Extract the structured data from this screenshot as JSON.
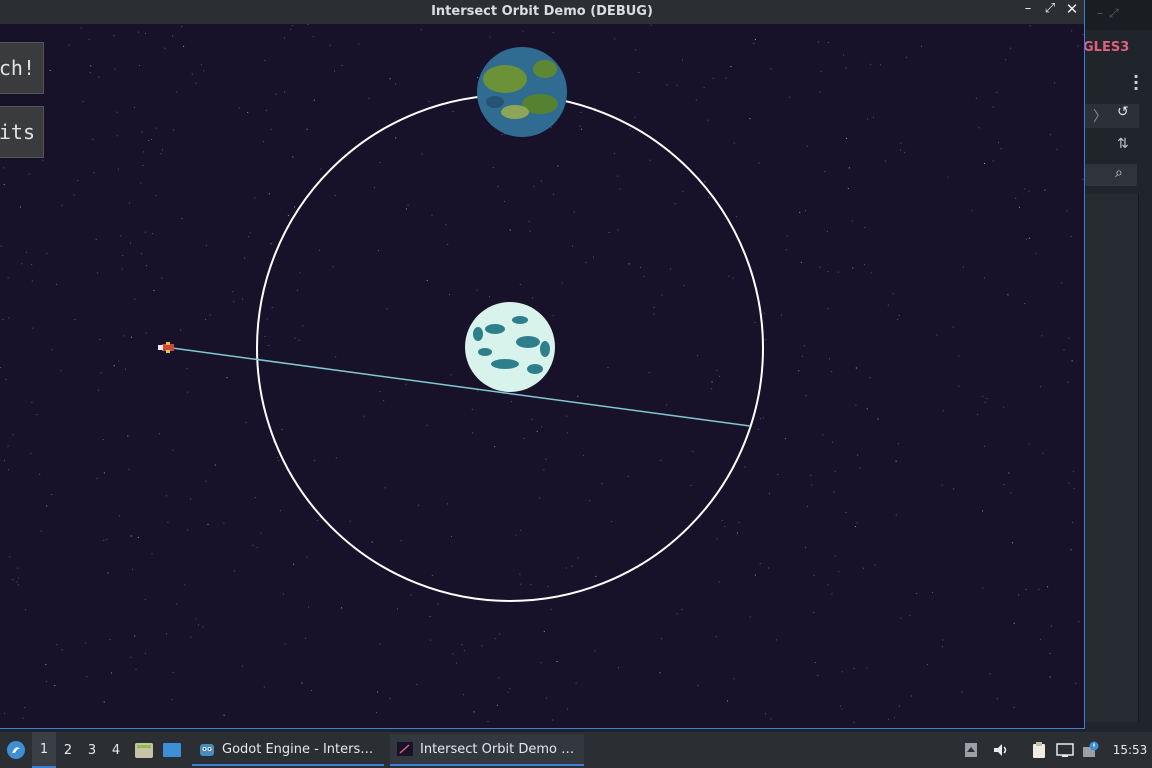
{
  "window": {
    "title": "Intersect Orbit Demo (DEBUG)",
    "controls": {
      "minimize": "–",
      "maximize": "⤢",
      "close": "✕"
    }
  },
  "game": {
    "buttons": {
      "launch": "Launch!",
      "credits": "Credits"
    },
    "colors": {
      "space": "#17122a",
      "orbit": "#ffffff",
      "trajectory": "#7fc8d0",
      "earth_ocean": "#3d8bb8",
      "earth_land": "#8cbf3f",
      "ice_planet": "#d8f2ec",
      "ice_planet_detail": "#2e7f8c"
    }
  },
  "editor_bg": {
    "renderer": "GLES3",
    "icons": [
      "kebab-icon",
      "history-icon",
      "tune-icon",
      "search-icon"
    ]
  },
  "taskbar": {
    "workspaces": [
      "1",
      "2",
      "3",
      "4"
    ],
    "active_workspace": "1",
    "tasks": [
      {
        "label": "Godot Engine - Inters…",
        "icon": "godot-icon"
      },
      {
        "label": "Intersect Orbit Demo …",
        "icon": "game-window-icon",
        "active": true
      }
    ],
    "clock": "15:53",
    "accent": "#3d7fd6"
  }
}
